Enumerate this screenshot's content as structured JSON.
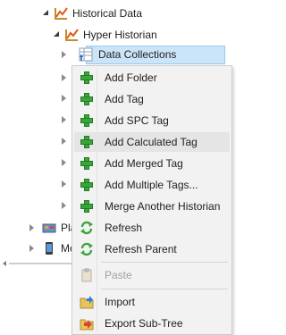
{
  "tree": {
    "historical_data": "Historical Data",
    "hyper_historian": "Hyper Historian",
    "data_collections": "Data Collections",
    "platform_partial": "Pla",
    "mo_partial": "Mo"
  },
  "menu": {
    "items": [
      {
        "label": "Add Folder",
        "icon": "add-icon"
      },
      {
        "label": "Add Tag",
        "icon": "add-icon"
      },
      {
        "label": "Add SPC Tag",
        "icon": "add-icon"
      },
      {
        "label": "Add Calculated Tag",
        "icon": "add-icon"
      },
      {
        "label": "Add Merged Tag",
        "icon": "add-icon"
      },
      {
        "label": "Add Multiple Tags...",
        "icon": "add-icon"
      },
      {
        "label": "Merge Another Historian",
        "icon": "add-icon"
      },
      {
        "label": "Refresh",
        "icon": "refresh-icon"
      },
      {
        "label": "Refresh Parent",
        "icon": "refresh-icon"
      },
      {
        "label": "Paste",
        "icon": "paste-icon",
        "disabled": true
      },
      {
        "label": "Import",
        "icon": "import-icon"
      },
      {
        "label": "Export Sub-Tree",
        "icon": "export-icon"
      }
    ]
  },
  "colors": {
    "selection": "#cce4f7",
    "menu_bg": "#f2f2f2",
    "hover": "#e5e5e5",
    "green_plus": "#3ca43c"
  }
}
